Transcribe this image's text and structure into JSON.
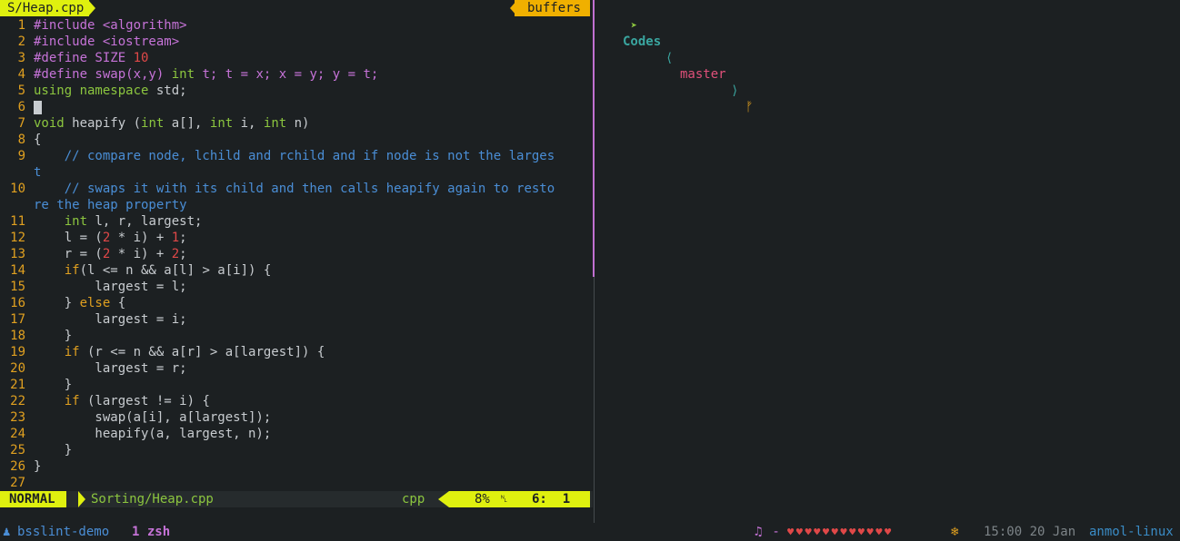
{
  "vim": {
    "tab_file": "S/Heap.cpp",
    "tab_buffers": "buffers",
    "lines": [
      {
        "n": "1",
        "segs": [
          [
            "pp",
            "#include "
          ],
          [
            "pp",
            "<algorithm>"
          ]
        ]
      },
      {
        "n": "2",
        "segs": [
          [
            "pp",
            "#include "
          ],
          [
            "pp",
            "<iostream>"
          ]
        ]
      },
      {
        "n": "3",
        "segs": [
          [
            "pp",
            "#define SIZE "
          ],
          [
            "num",
            "10"
          ]
        ]
      },
      {
        "n": "4",
        "segs": [
          [
            "pp",
            "#define swap(x,y) "
          ],
          [
            "ty",
            "int"
          ],
          [
            "pp",
            " t; t = x; x = y; y = t;"
          ]
        ]
      },
      {
        "n": "5",
        "segs": [
          [
            "kw",
            "using namespace "
          ],
          [
            "id",
            "std;"
          ]
        ]
      },
      {
        "n": "6",
        "segs": [],
        "cursor": true
      },
      {
        "n": "7",
        "segs": [
          [
            "ty",
            "void"
          ],
          [
            "id",
            " heapify ("
          ],
          [
            "ty",
            "int"
          ],
          [
            "id",
            " a[], "
          ],
          [
            "ty",
            "int"
          ],
          [
            "id",
            " i, "
          ],
          [
            "ty",
            "int"
          ],
          [
            "id",
            " n)"
          ]
        ]
      },
      {
        "n": "8",
        "segs": [
          [
            "id",
            "{"
          ]
        ]
      },
      {
        "n": "9",
        "segs": [
          [
            "cm",
            "    // compare node, lchild and rchild and if node is not the larges"
          ]
        ]
      },
      {
        "n": "",
        "segs": [
          [
            "cm",
            "t"
          ]
        ]
      },
      {
        "n": "10",
        "segs": [
          [
            "cm",
            "    // swaps it with its child and then calls heapify again to resto"
          ]
        ]
      },
      {
        "n": "",
        "segs": [
          [
            "cm",
            "re the heap property"
          ]
        ]
      },
      {
        "n": "11",
        "segs": [
          [
            "ty",
            "    int"
          ],
          [
            "id",
            " l, r, largest;"
          ]
        ]
      },
      {
        "n": "12",
        "segs": [
          [
            "id",
            "    l = ("
          ],
          [
            "num",
            "2"
          ],
          [
            "id",
            " * i) + "
          ],
          [
            "num",
            "1"
          ],
          [
            "id",
            ";"
          ]
        ]
      },
      {
        "n": "13",
        "segs": [
          [
            "id",
            "    r = ("
          ],
          [
            "num",
            "2"
          ],
          [
            "id",
            " * i) + "
          ],
          [
            "num",
            "2"
          ],
          [
            "id",
            ";"
          ]
        ]
      },
      {
        "n": "14",
        "segs": [
          [
            "st",
            "    if"
          ],
          [
            "id",
            "(l <= n && a[l] > a[i]) {"
          ]
        ]
      },
      {
        "n": "15",
        "segs": [
          [
            "id",
            "        largest = l;"
          ]
        ]
      },
      {
        "n": "16",
        "segs": [
          [
            "id",
            "    } "
          ],
          [
            "st",
            "else"
          ],
          [
            "id",
            " {"
          ]
        ]
      },
      {
        "n": "17",
        "segs": [
          [
            "id",
            "        largest = i;"
          ]
        ]
      },
      {
        "n": "18",
        "segs": [
          [
            "id",
            "    }"
          ]
        ]
      },
      {
        "n": "19",
        "segs": [
          [
            "st",
            "    if"
          ],
          [
            "id",
            " (r <= n && a[r] > a[largest]) {"
          ]
        ]
      },
      {
        "n": "20",
        "segs": [
          [
            "id",
            "        largest = r;"
          ]
        ]
      },
      {
        "n": "21",
        "segs": [
          [
            "id",
            "    }"
          ]
        ]
      },
      {
        "n": "22",
        "segs": [
          [
            "st",
            "    if"
          ],
          [
            "id",
            " (largest != i) {"
          ]
        ]
      },
      {
        "n": "23",
        "segs": [
          [
            "id",
            "        swap(a[i], a[largest]);"
          ]
        ]
      },
      {
        "n": "24",
        "segs": [
          [
            "id",
            "        heapify(a, largest, n);"
          ]
        ]
      },
      {
        "n": "25",
        "segs": [
          [
            "id",
            "    }"
          ]
        ]
      },
      {
        "n": "26",
        "segs": [
          [
            "id",
            "}"
          ]
        ]
      },
      {
        "n": "27",
        "segs": []
      }
    ],
    "status": {
      "mode": "NORMAL",
      "file": "Sorting/Heap.cpp",
      "filetype": "cpp",
      "percent": "8%",
      "ln_icon": "␤",
      "position": "6:  1"
    }
  },
  "shell": {
    "prompt_arrow": "➤",
    "dir": "Codes",
    "branch_open": "⟨",
    "branch": "master",
    "branch_close": "⟩",
    "dirty_mark": "ᚠ"
  },
  "tmux": {
    "session_icon": "♟",
    "session": "bsslint-demo",
    "window": "1 zsh",
    "music_icon": "♫",
    "music_text": " - ",
    "hearts": "♥♥♥♥♥♥♥♥♥♥♥♥",
    "battery_icon": "❄",
    "time": "15:00 20 Jan",
    "host": "anmol-linux"
  },
  "colors": {
    "bg": "#1c2022",
    "mode_bg": "#dff00f",
    "buffers_bg": "#f0b000",
    "line_number": "#e0a020",
    "comment": "#4a8ed6",
    "preproc": "#c673d8",
    "type": "#8cc63f",
    "number": "#e04848"
  }
}
